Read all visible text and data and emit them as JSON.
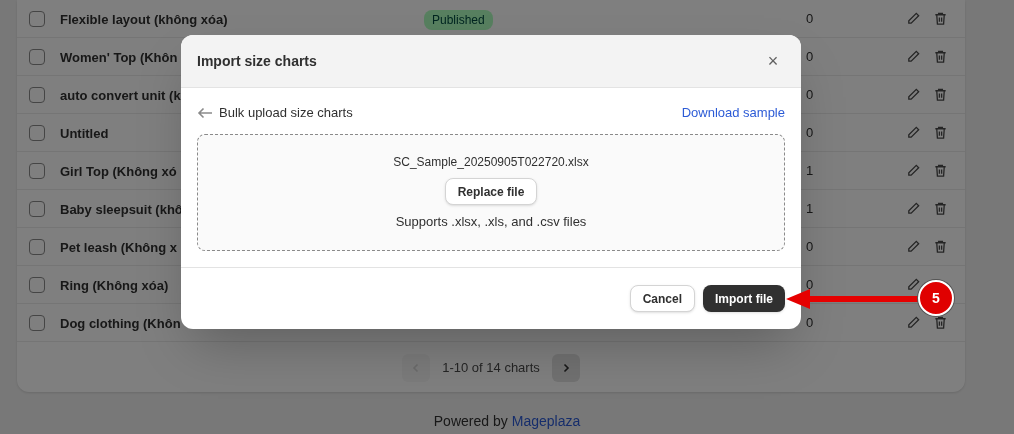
{
  "table": {
    "rows": [
      {
        "name": "Flexible layout (không xóa)",
        "status": "Published",
        "count": "0",
        "checked": false
      },
      {
        "name": "Women' Top (Khôn",
        "count": "0",
        "checked": false
      },
      {
        "name": "auto convert unit (k",
        "count": "0",
        "checked": false
      },
      {
        "name": "Untitled",
        "count": "0",
        "checked": false
      },
      {
        "name": "Girl Top (Không xó",
        "count": "1",
        "checked": false
      },
      {
        "name": "Baby sleepsuit (khô",
        "count": "1",
        "checked": false
      },
      {
        "name": "Pet leash (Không x",
        "count": "0",
        "checked": false
      },
      {
        "name": "Ring (Không xóa)",
        "count": "0",
        "checked": false,
        "delete_hidden": true
      },
      {
        "name": "Dog clothing (Khôn",
        "count": "0",
        "checked": false
      }
    ]
  },
  "pagination": {
    "label": "1-10 of 14 charts",
    "prev_disabled": true
  },
  "footer": {
    "text": "Powered by",
    "link": "Mageplaza"
  },
  "modal": {
    "title": "Import size charts",
    "close": "×",
    "back_label": "Bulk upload size charts",
    "download_link": "Download sample",
    "file_name": "SC_Sample_20250905T022720.xlsx",
    "replace_button": "Replace file",
    "hint": "Supports .xlsx, .xls, and .csv files",
    "buttons": [
      "Cancel",
      "Import file"
    ]
  },
  "annotation": {
    "step": "5"
  }
}
